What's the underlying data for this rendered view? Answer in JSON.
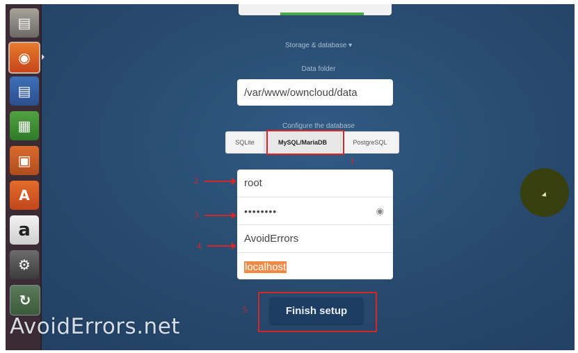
{
  "launcher": {
    "items": [
      {
        "name": "files",
        "glyph": "▤"
      },
      {
        "name": "firefox",
        "glyph": "◉"
      },
      {
        "name": "writer",
        "glyph": "▤"
      },
      {
        "name": "calc",
        "glyph": "▦"
      },
      {
        "name": "impress",
        "glyph": "▣"
      },
      {
        "name": "software-center",
        "glyph": "A"
      },
      {
        "name": "amazon",
        "glyph": "a"
      },
      {
        "name": "settings",
        "glyph": "⚙"
      },
      {
        "name": "updater",
        "glyph": "↻"
      }
    ]
  },
  "form": {
    "storage_label": "Storage & database ▾",
    "data_folder_label": "Data folder",
    "data_folder_value": "/var/www/owncloud/data",
    "configure_label": "Configure the database",
    "db_options": [
      "SQLite",
      "MySQL/MariaDB",
      "PostgreSQL"
    ],
    "selected_db": "MySQL/MariaDB",
    "db_user": "root",
    "db_password_mask": "••••••••",
    "db_name": "AvoidErrors",
    "db_host": "localhost",
    "finish_label": "Finish setup"
  },
  "annotations": {
    "n1": "1",
    "n2": "2",
    "n3": "3",
    "n4": "4",
    "n5": "5"
  },
  "watermark": "AvoidErrors.net",
  "colors": {
    "background": "#2a4b6f",
    "finish_button": "#1d3e62",
    "annotation_red": "#d62626",
    "selection_highlight": "#f28a46"
  }
}
